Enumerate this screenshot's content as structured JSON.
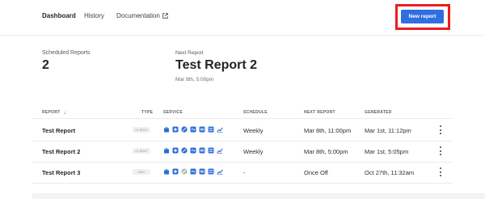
{
  "nav": {
    "dashboard": "Dashboard",
    "history": "History",
    "documentation": "Documentation",
    "new_report": "New report"
  },
  "summary": {
    "scheduled_label": "Scheduled Reports",
    "scheduled_count": "2",
    "next_label": "Next Report",
    "next_title": "Test Report 2",
    "next_date": "Mar 8th, 5:00pm"
  },
  "table": {
    "headers": {
      "report": "REPORT",
      "type": "TYPE",
      "service": "SERVICE",
      "schedule": "SCHEDULE",
      "next_report": "NEXT REPORT",
      "generated": "GENERATED"
    },
    "rows": [
      {
        "name": "Test Report",
        "type": "CLIENT",
        "schedule": "Weekly",
        "next_report": "Mar 8th, 11:00pm",
        "generated": "Mar 1st, 11:12pm",
        "services": [
          "shopify-icon",
          "mailchimp-icon",
          "blue-circle-icon",
          "meta-icon",
          "stripe-icon",
          "bars-icon",
          "trend-icon"
        ]
      },
      {
        "name": "Test Report 2",
        "type": "CLIENT",
        "schedule": "Weekly",
        "next_report": "Mar 8th, 5:00pm",
        "generated": "Mar 1st, 5:05pm",
        "services": [
          "shopify-icon",
          "mailchimp-icon",
          "blue-circle-icon",
          "meta-icon",
          "stripe-icon",
          "bars-icon",
          "trend-icon"
        ]
      },
      {
        "name": "Test Report 3",
        "type": "DEV",
        "schedule": "-",
        "next_report": "Once Off",
        "generated": "Oct 27th, 11:32am",
        "services": [
          "shopify-icon",
          "mailchimp-icon",
          "grey-circle-icon",
          "meta-icon",
          "stripe-icon",
          "bars-icon",
          "trend-icon"
        ]
      }
    ]
  },
  "colors": {
    "accent": "#2f6fe0",
    "highlight": "#ee1c1c",
    "service_blue": "#2c6bd8",
    "service_grey": "#b7bbc1"
  }
}
